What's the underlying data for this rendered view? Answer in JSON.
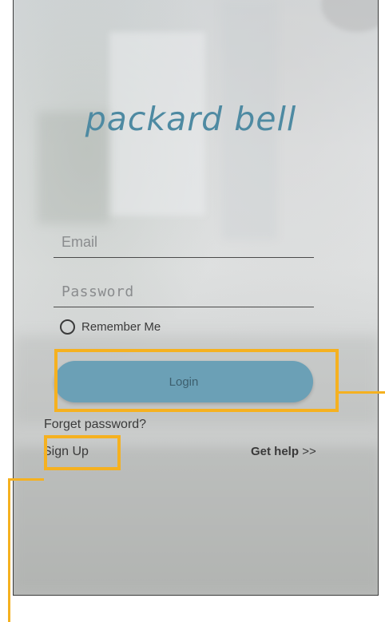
{
  "brand": {
    "logo_text": "packard bell"
  },
  "form": {
    "email_placeholder": "Email",
    "password_placeholder": "Password",
    "remember_label": "Remember Me",
    "remember_checked": false,
    "login_label": "Login"
  },
  "links": {
    "forget_password": "Forget password?",
    "sign_up": "Sign Up",
    "get_help": "Get help",
    "get_help_suffix": ">>"
  },
  "colors": {
    "accent": "#6ba0b6",
    "logo": "#4e8aa2",
    "highlight": "#f5b120"
  }
}
